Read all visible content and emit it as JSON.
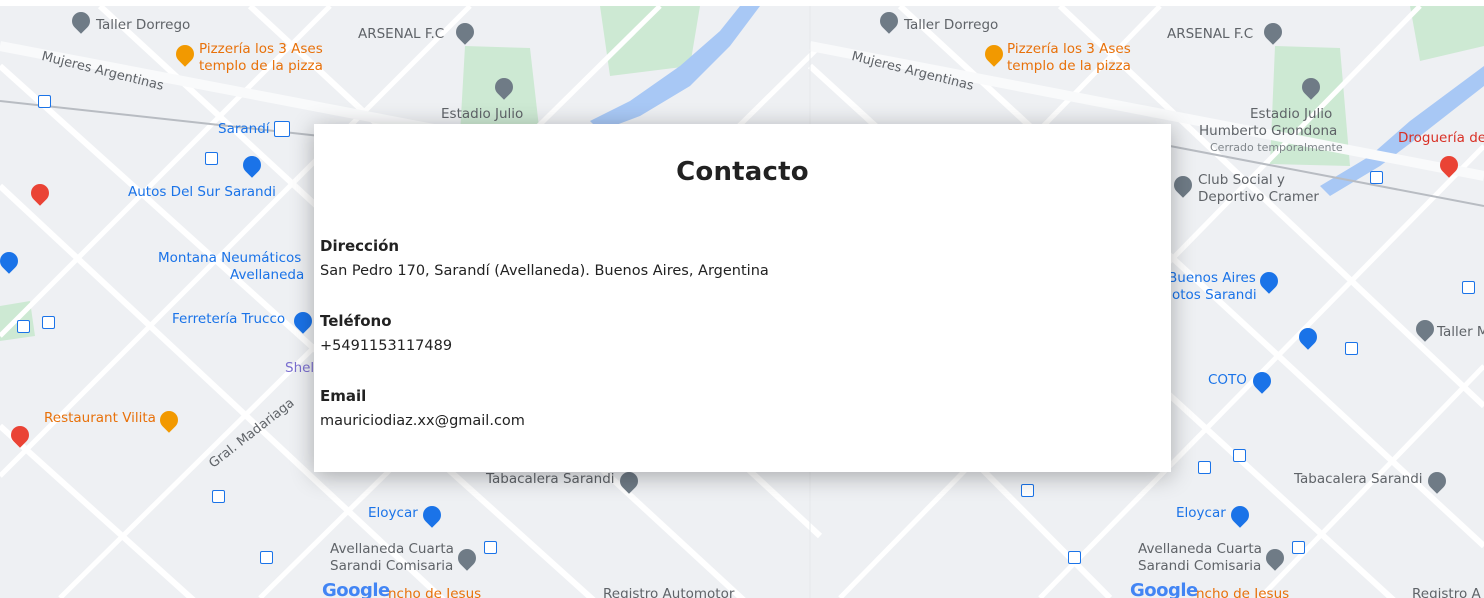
{
  "card": {
    "title": "Contacto",
    "address_label": "Dirección",
    "address_value": "San Pedro 170, Sarandí (Avellaneda). Buenos Aires, Argentina",
    "phone_label": "Teléfono",
    "phone_value": "+5491153117489",
    "email_label": "Email",
    "email_value": "mauriciodiaz.xx@gmail.com"
  },
  "map": {
    "left": {
      "taller": "Taller Dorrego",
      "pizzeria_1": "Pizzería los 3 Ases",
      "pizzeria_2": "templo de la pizza",
      "arsenal": "ARSENAL F.C",
      "estadio": "Estadio Julio",
      "sarandi": "Sarandí",
      "autos": "Autos Del Sur Sarandi",
      "montana_1": "Montana Neumáticos",
      "montana_2": "Avellaneda",
      "ferreteria": "Ferretería Trucco",
      "shell": "Shel",
      "restaurant": "Restaurant Vilita",
      "tabacalera": "Tabacalera Sarandi",
      "eloycar": "Eloycar",
      "comisaria_1": "Avellaneda Cuarta",
      "comisaria_2": "Sarandi Comisaria",
      "registro": "Registro Automotor",
      "mujeres": "Mujeres Argentinas",
      "madariaga": "Gral. Madariaga",
      "google": "Google",
      "rancho": "ncho de Jesus"
    },
    "right": {
      "taller": "Taller Dorrego",
      "pizzeria_1": "Pizzería los 3 Ases",
      "pizzeria_2": "templo de la pizza",
      "arsenal": "ARSENAL F.C",
      "estadio_1": "Estadio Julio",
      "estadio_2": "Humberto Grondona",
      "estadio_3": "Cerrado temporalmente",
      "drogueria": "Droguería de",
      "club_1": "Club Social y",
      "club_2": "Deportivo Cramer",
      "bsas_1": "Buenos Aires",
      "bsas_2": "otos Sarandi",
      "taller_m": "Taller M",
      "coto": "COTO",
      "tabacalera": "Tabacalera Sarandi",
      "eloycar": "Eloycar",
      "comisaria_1": "Avellaneda Cuarta",
      "comisaria_2": "Sarandi Comisaria",
      "registro": "Registro A",
      "mujeres": "Mujeres Argentinas",
      "google": "Google",
      "rancho": "ncho de Jesus"
    }
  }
}
